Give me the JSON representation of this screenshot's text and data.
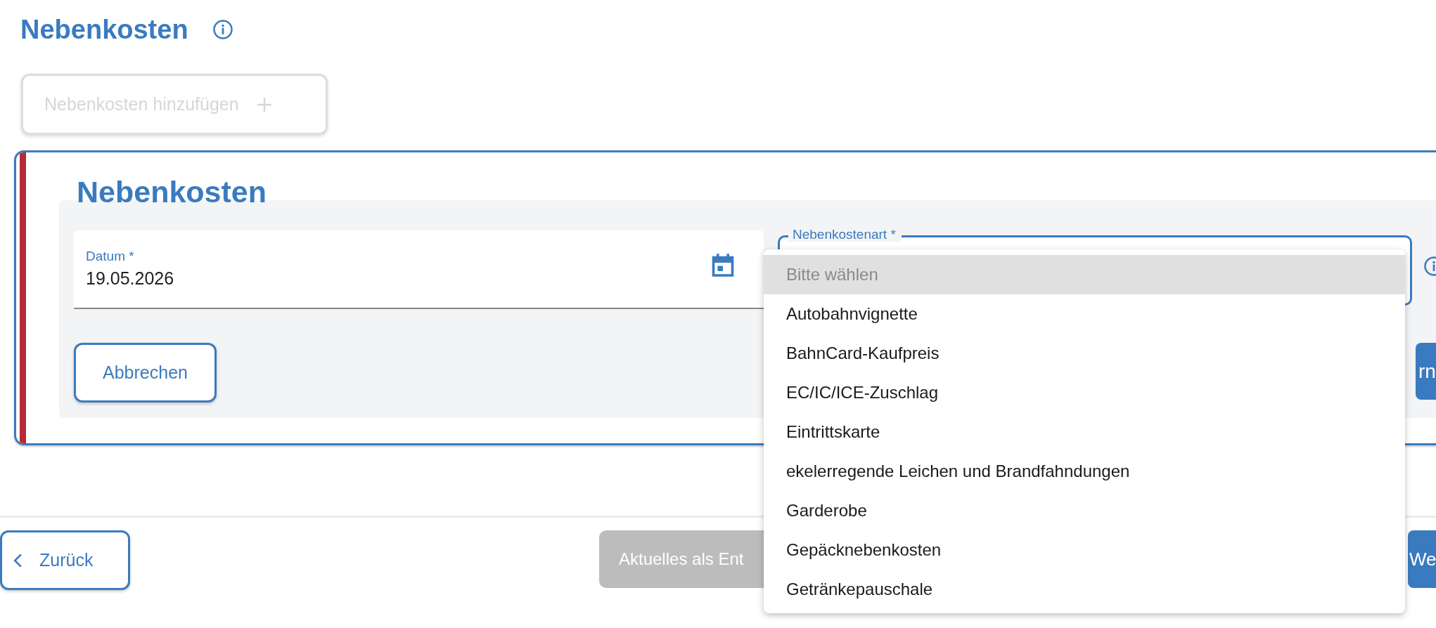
{
  "page": {
    "title": "Nebenkosten"
  },
  "add_button": {
    "label": "Nebenkosten hinzufügen",
    "disabled": true
  },
  "card": {
    "title": "Nebenkosten",
    "date_field": {
      "label": "Datum *",
      "value": "19.05.2026"
    },
    "type_field": {
      "label": "Nebenkostenart *"
    },
    "cancel_button": "Abbrechen",
    "save_button": "rn"
  },
  "dropdown": {
    "options": [
      {
        "label": "Bitte wählen",
        "kind": "placeholder",
        "selected": true
      },
      {
        "label": "Autobahnvignette",
        "kind": "option",
        "selected": false
      },
      {
        "label": "BahnCard-Kaufpreis",
        "kind": "option",
        "selected": false
      },
      {
        "label": "EC/IC/ICE-Zuschlag",
        "kind": "option",
        "selected": false
      },
      {
        "label": "Eintrittskarte",
        "kind": "option",
        "selected": false
      },
      {
        "label": "ekelerregende Leichen und Brandfahndungen",
        "kind": "option",
        "selected": false
      },
      {
        "label": "Garderobe",
        "kind": "option",
        "selected": false
      },
      {
        "label": "Gepäcknebenkosten",
        "kind": "option",
        "selected": false
      },
      {
        "label": "Getränkepauschale",
        "kind": "option",
        "selected": false
      }
    ]
  },
  "footer": {
    "back_button": "Zurück",
    "draft_button": {
      "label": "Aktuelles als Ent",
      "disabled": true
    },
    "next_button": "We"
  }
}
